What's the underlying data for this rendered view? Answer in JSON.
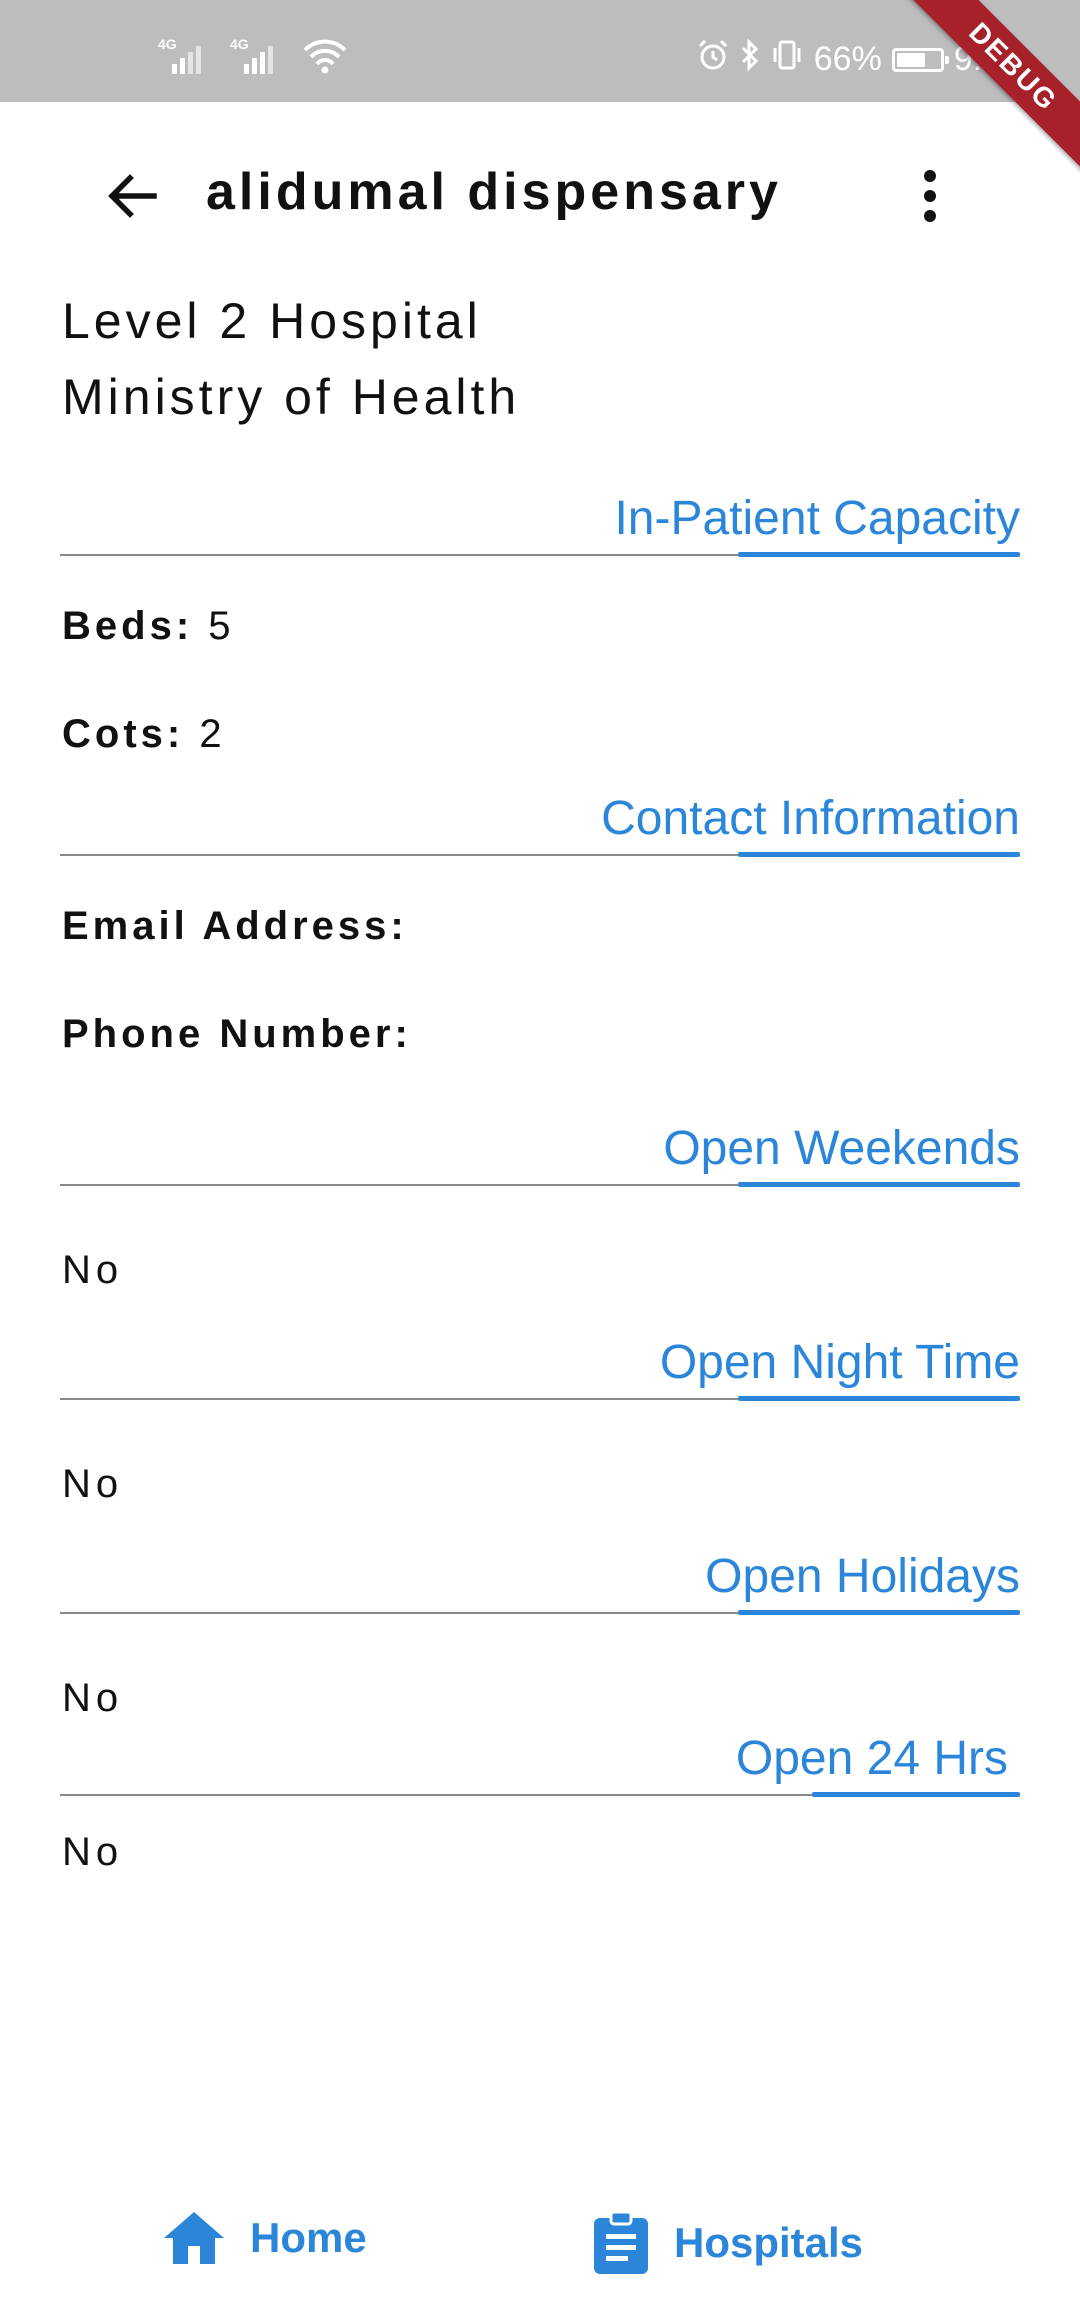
{
  "status_bar": {
    "sim1_network": "4G",
    "sim2_network": "4G",
    "battery_text": "66%",
    "battery_level": 0.66,
    "time": "9:35"
  },
  "debug_banner": "DEBUG",
  "app_bar": {
    "title": "alidumal dispensary",
    "back_icon": "arrow-back-icon",
    "menu_icon": "more-vert-icon"
  },
  "facility": {
    "level": "Level 2 Hospital",
    "owner": "Ministry of Health"
  },
  "sections": {
    "inpatient": {
      "title": "In-Patient Capacity",
      "beds_label": "Beds:",
      "beds_value": "5",
      "cots_label": "Cots:",
      "cots_value": "2"
    },
    "contact": {
      "title": "Contact Information",
      "email_label": "Email Address:",
      "phone_label": "Phone Number:"
    },
    "weekends": {
      "title": "Open Weekends",
      "value": "No"
    },
    "night": {
      "title": "Open Night Time",
      "value": "No"
    },
    "holidays": {
      "title": "Open Holidays",
      "value": "No"
    },
    "hrs24": {
      "title": "Open 24 Hrs",
      "value": "No"
    }
  },
  "bottom_nav": {
    "home_label": "Home",
    "home_icon": "home-icon",
    "hospitals_label": "Hospitals",
    "hospitals_icon": "clipboard-icon"
  },
  "colors": {
    "accent": "#2b86da",
    "status_bar": "#bdbdbd",
    "debug_ribbon": "#a7212b",
    "divider": "#888888"
  }
}
